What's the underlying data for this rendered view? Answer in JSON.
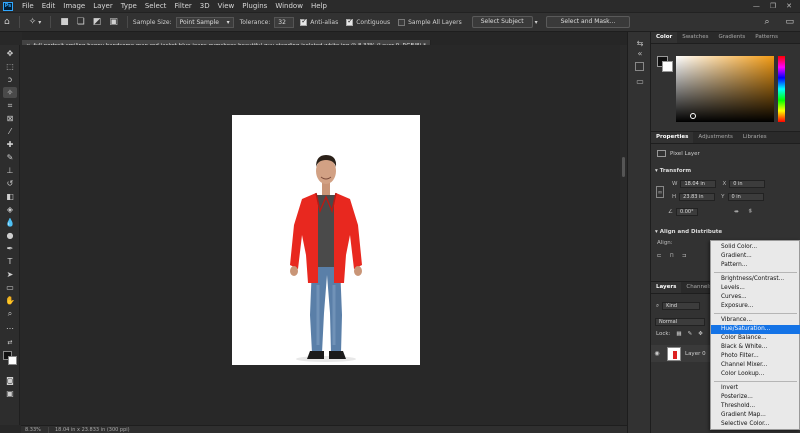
{
  "menu": {
    "items": [
      "File",
      "Edit",
      "Image",
      "Layer",
      "Type",
      "Select",
      "Filter",
      "3D",
      "View",
      "Plugins",
      "Window",
      "Help"
    ]
  },
  "options": {
    "sample_size_label": "Sample Size:",
    "sample_size_value": "Point Sample",
    "tolerance_label": "Tolerance:",
    "tolerance_value": "32",
    "anti_alias_label": "Anti-alias",
    "contiguous_label": "Contiguous",
    "sample_all_layers_label": "Sample All Layers",
    "select_subject_label": "Select Subject",
    "select_and_mask_label": "Select and Mask..."
  },
  "document": {
    "tab_title": "full-portrait-smiling-happy-handsome-man-red-jacket-blue-jeans-gymshoes-beautiful-guy-standing-isolated-white.jpg @ 8.33% (Layer 0, RGB/8) *",
    "zoom": "8.33%",
    "status_info": "18.04 in x 23.833 in (300 ppi)"
  },
  "color_panel": {
    "tabs": [
      "Color",
      "Swatches",
      "Gradients",
      "Patterns"
    ]
  },
  "properties_panel": {
    "tabs": [
      "Properties",
      "Adjustments",
      "Libraries"
    ],
    "layer_type": "Pixel Layer",
    "transform_title": "Transform",
    "w_label": "W",
    "w_value": "18.04 in",
    "h_label": "H",
    "h_value": "23.83 in",
    "x_label": "X",
    "x_value": "0 in",
    "y_label": "Y",
    "y_value": "0 in",
    "angle_value": "0.00°",
    "align_title": "Align and Distribute",
    "align_label": "Align:"
  },
  "layers_panel": {
    "tabs": [
      "Layers",
      "Channels"
    ],
    "filter_value": "Kind",
    "blend_mode": "Normal",
    "lock_label": "Lock:",
    "layer_name": "Layer 0"
  },
  "adjustment_menu": {
    "items": [
      "Solid Color...",
      "Gradient...",
      "Pattern...",
      "Brightness/Contrast...",
      "Levels...",
      "Curves...",
      "Exposure...",
      "Vibrance...",
      "Hue/Saturation...",
      "Color Balance...",
      "Black & White...",
      "Photo Filter...",
      "Channel Mixer...",
      "Color Lookup...",
      "Invert",
      "Posterize...",
      "Threshold...",
      "Gradient Map...",
      "Selective Color..."
    ],
    "highlighted": "Hue/Saturation..."
  },
  "colors": {
    "accent": "#1473e6",
    "foreground": "#111111",
    "background": "#ffffff"
  }
}
